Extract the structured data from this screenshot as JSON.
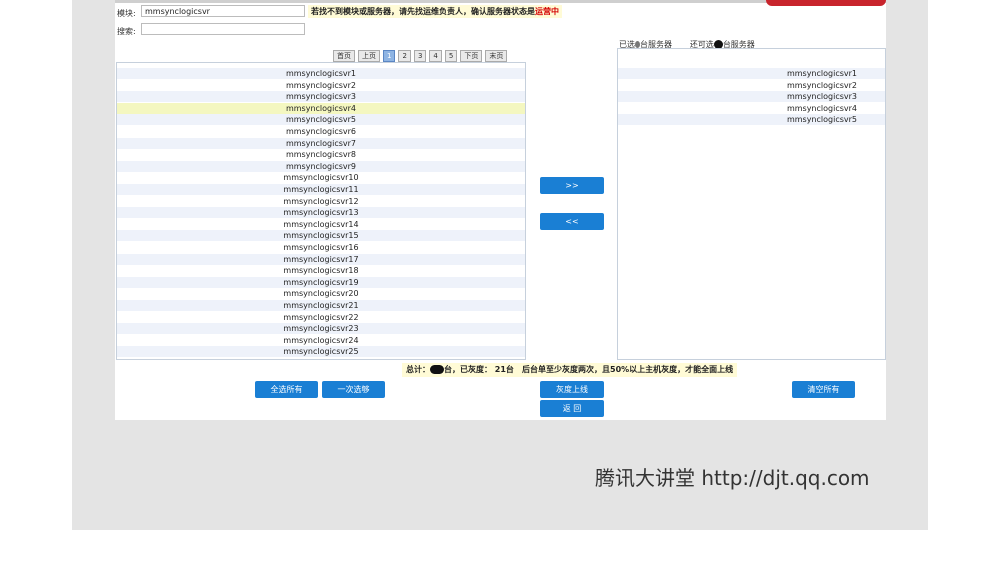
{
  "form": {
    "module_label": "模块:",
    "module_value": "mmsynclogicsvr",
    "search_label": "搜索:",
    "search_value": "",
    "notice_text": "若找不到模块或服务器，请先找运维负责人，确认服务器状态是",
    "notice_highlight": "运营中"
  },
  "pager": {
    "first": "首页",
    "prev": "上页",
    "pages": [
      "1",
      "2",
      "3",
      "4",
      "5"
    ],
    "active_page": "1",
    "next": "下页",
    "last": "末页"
  },
  "available_servers": [
    "mmsynclogicsvr1",
    "mmsynclogicsvr2",
    "mmsynclogicsvr3",
    "mmsynclogicsvr4",
    "mmsynclogicsvr5",
    "mmsynclogicsvr6",
    "mmsynclogicsvr7",
    "mmsynclogicsvr8",
    "mmsynclogicsvr9",
    "mmsynclogicsvr10",
    "mmsynclogicsvr11",
    "mmsynclogicsvr12",
    "mmsynclogicsvr13",
    "mmsynclogicsvr14",
    "mmsynclogicsvr15",
    "mmsynclogicsvr16",
    "mmsynclogicsvr17",
    "mmsynclogicsvr18",
    "mmsynclogicsvr19",
    "mmsynclogicsvr20",
    "mmsynclogicsvr21",
    "mmsynclogicsvr22",
    "mmsynclogicsvr23",
    "mmsynclogicsvr24",
    "mmsynclogicsvr25"
  ],
  "highlighted_server": "mmsynclogicsvr4",
  "selected_header": {
    "selected_prefix": "已选",
    "selected_suffix": "台服务器",
    "remaining_prefix": "还可选",
    "remaining_suffix": "台服务器"
  },
  "selected_servers": [
    "mmsynclogicsvr1",
    "mmsynclogicsvr2",
    "mmsynclogicsvr3",
    "mmsynclogicsvr4",
    "mmsynclogicsvr5"
  ],
  "transfer": {
    "add": ">>",
    "remove": "<<"
  },
  "summary": {
    "total_prefix": "总计：",
    "total_suffix": "台，已灰度： 21台",
    "rule": "后台单至少灰度两次，且50%以上主机灰度，才能全面上线"
  },
  "buttons": {
    "select_all": "全选所有",
    "select_once": "一次选够",
    "gray_release": "灰度上线",
    "back": "返 回",
    "clear_all": "清空所有"
  },
  "watermark": "腾讯大讲堂 http://djt.qq.com",
  "colors": {
    "button_blue": "#1a7fd4",
    "notice_bg": "#fffbd6",
    "notice_highlight": "#d40000",
    "row_stripe": "#eef2fa",
    "row_highlight": "#f4f7c0"
  }
}
